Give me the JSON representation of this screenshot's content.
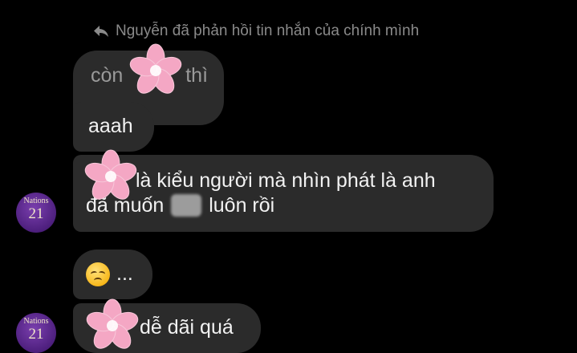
{
  "reply_note": {
    "icon": "reply-arrow-icon",
    "text": "Nguyễn đã phản hồi tin nhắn của chính mình"
  },
  "messages": [
    {
      "id": "m1",
      "text": "còn",
      "text_after": "thì"
    },
    {
      "id": "m2",
      "text": "aaah"
    },
    {
      "id": "m3",
      "line1": "là kiểu người mà nhìn phát là anh",
      "line2_before": "đã muốn",
      "line2_after": "luôn rồi"
    },
    {
      "id": "m4",
      "emoji": "pensive-face-icon",
      "text": "..."
    },
    {
      "id": "m5",
      "text": "dễ dãi quá"
    }
  ],
  "avatar": {
    "top": "Nations",
    "num": "21"
  },
  "colors": {
    "background": "#000000",
    "bubble": "#2b2b2b",
    "text": "#f2f2f2",
    "muted": "#8a8a8a",
    "flower": "#f4a7c4"
  }
}
